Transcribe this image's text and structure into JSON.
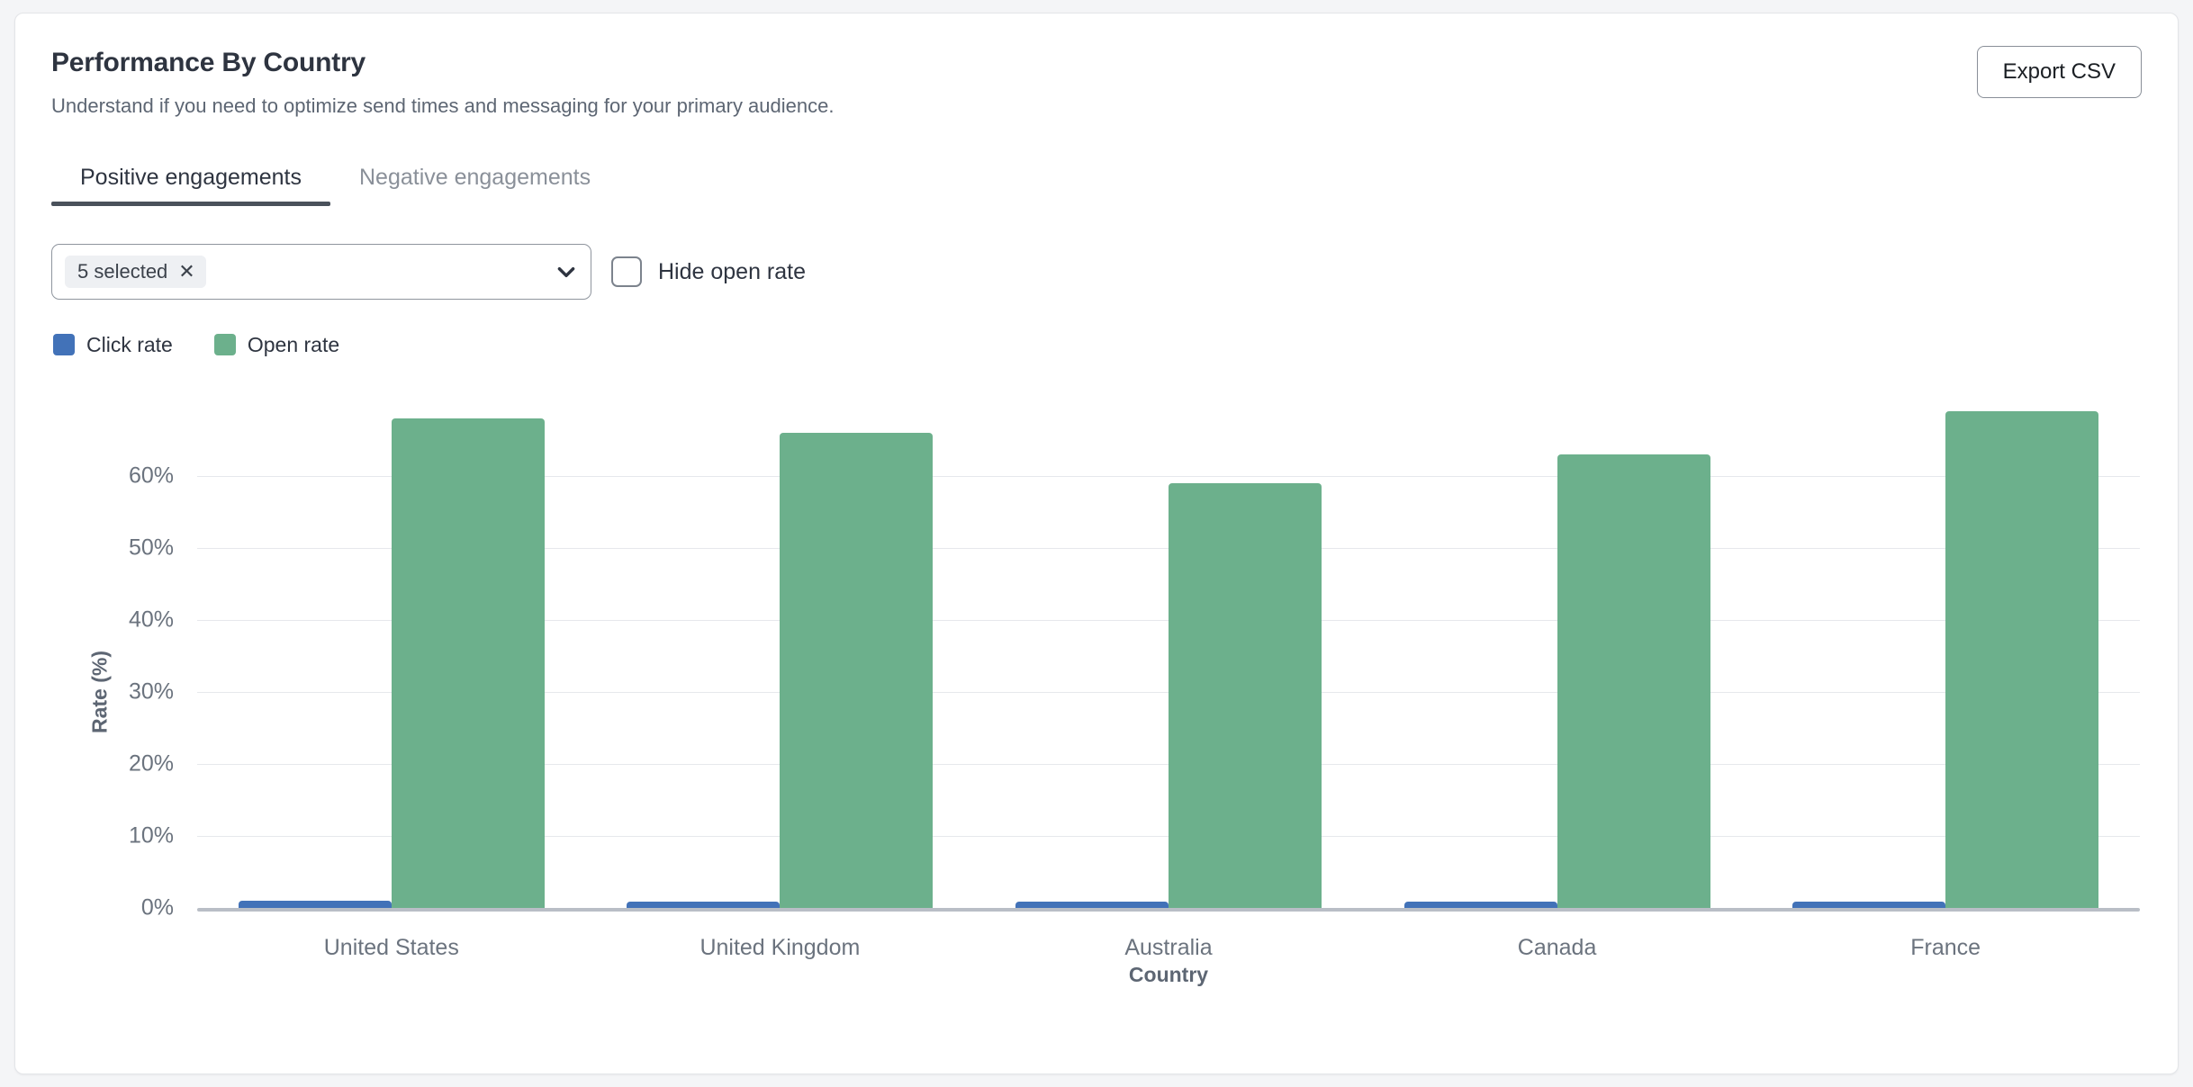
{
  "card": {
    "title": "Performance By Country",
    "subtitle": "Understand if you need to optimize send times and messaging for your primary audience.",
    "export_label": "Export CSV"
  },
  "tabs": [
    {
      "label": "Positive engagements",
      "active": true
    },
    {
      "label": "Negative engagements",
      "active": false
    }
  ],
  "controls": {
    "multiselect": {
      "chip_label": "5 selected",
      "remove_icon": "close-icon",
      "chevron_icon": "chevron-down-icon"
    },
    "hide_open_rate": {
      "label": "Hide open rate",
      "checked": false
    }
  },
  "colors": {
    "click_rate": "#4272b8",
    "open_rate": "#6cb08c",
    "grid": "#e6e8ec",
    "axis": "#b9bec6",
    "tab_active_underline": "#4a515b"
  },
  "chart_data": {
    "type": "bar",
    "title": "Performance By Country",
    "xlabel": "Country",
    "ylabel": "Rate (%)",
    "categories": [
      "United States",
      "United Kingdom",
      "Australia",
      "Canada",
      "France"
    ],
    "series": [
      {
        "name": "Click rate",
        "color": "#4272b8",
        "values": [
          1.0,
          0.9,
          0.9,
          0.9,
          0.9
        ]
      },
      {
        "name": "Open rate",
        "color": "#6cb08c",
        "values": [
          68.0,
          66.0,
          59.0,
          63.0,
          69.0
        ]
      }
    ],
    "ylim": [
      0,
      72
    ],
    "yticks": [
      0,
      10,
      20,
      30,
      40,
      50,
      60
    ],
    "ytick_labels": [
      "0%",
      "10%",
      "20%",
      "30%",
      "40%",
      "50%",
      "60%"
    ],
    "grid": true,
    "legend_position": "top-left"
  }
}
